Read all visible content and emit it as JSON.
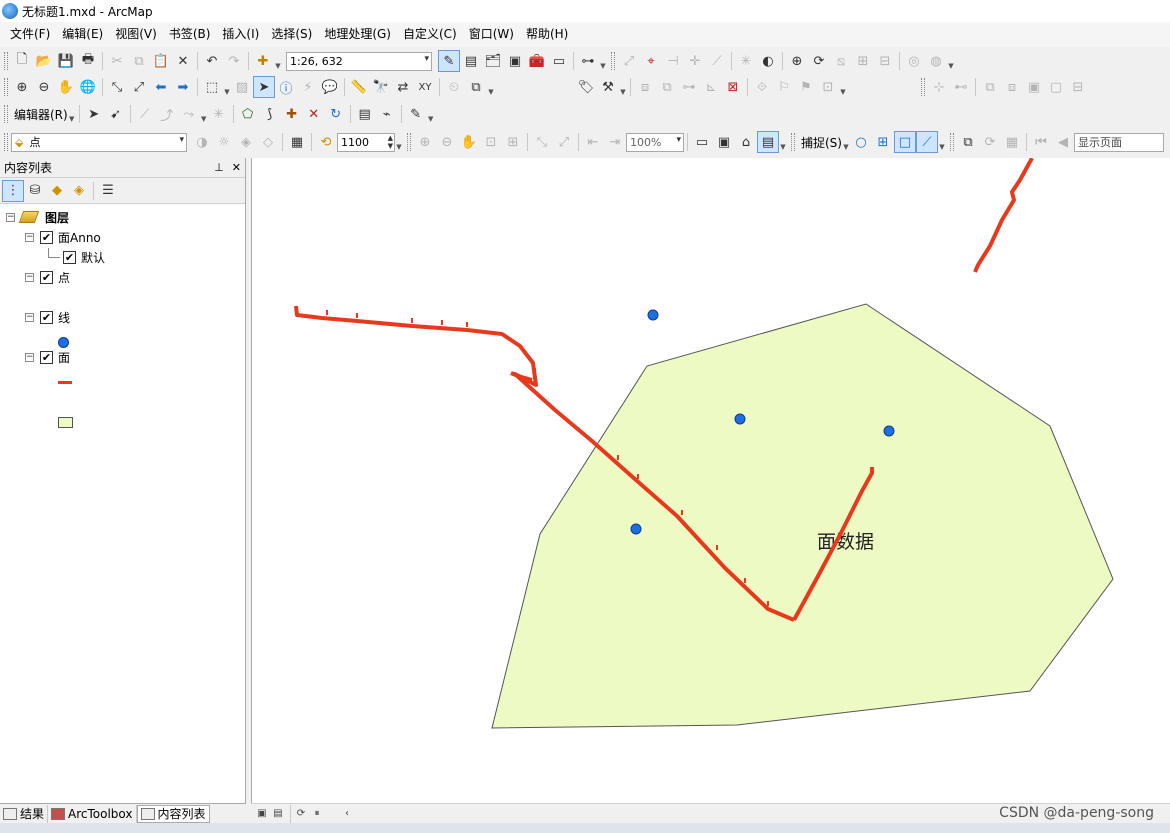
{
  "window": {
    "title": "无标题1.mxd - ArcMap"
  },
  "menu": [
    "文件(F)",
    "编辑(E)",
    "视图(V)",
    "书签(B)",
    "插入(I)",
    "选择(S)",
    "地理处理(G)",
    "自定义(C)",
    "窗口(W)",
    "帮助(H)"
  ],
  "toolbar": {
    "scale_value": "1:26, 632",
    "editor_label": "编辑器(R)",
    "layer_select": "点",
    "rotation_value": "1100",
    "zoom_percent": "100%",
    "snapping_label": "捕捉(S)",
    "display_page": "显示页面"
  },
  "toc": {
    "title": "内容列表",
    "pin": "ᵖ",
    "close": "✕",
    "group_label": "图层",
    "layers": [
      {
        "label": "面Anno",
        "sub": "默认"
      },
      {
        "label": "点"
      },
      {
        "label": "线"
      },
      {
        "label": "面"
      }
    ]
  },
  "map": {
    "annotation": "面数据",
    "colors": {
      "polygon_fill": "#eefac3",
      "polygon_stroke": "#555555",
      "line": "#e8391d",
      "point": "#1f6fe0"
    }
  },
  "bottom_tabs": [
    "结果",
    "ArcToolbox",
    "内容列表"
  ],
  "watermark": "CSDN @da-peng-song"
}
